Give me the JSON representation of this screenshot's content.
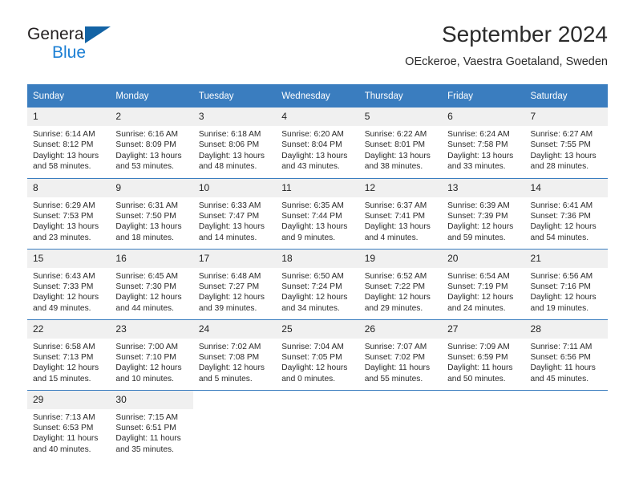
{
  "brand": {
    "name_part1": "General",
    "name_part2": "Blue",
    "flag_color": "#1363a5",
    "blue_color": "#1c7fd4"
  },
  "header": {
    "title": "September 2024",
    "subtitle": "OEckeroe, Vaestra Goetaland, Sweden"
  },
  "theme": {
    "header_bg": "#3a7dbf",
    "daynum_bg": "#f0f0f0",
    "grid_line": "#3a7dbf"
  },
  "weekday_headers": [
    "Sunday",
    "Monday",
    "Tuesday",
    "Wednesday",
    "Thursday",
    "Friday",
    "Saturday"
  ],
  "weeks": [
    [
      {
        "day": "1",
        "sunrise": "Sunrise: 6:14 AM",
        "sunset": "Sunset: 8:12 PM",
        "daylight_line1": "Daylight: 13 hours",
        "daylight_line2": "and 58 minutes."
      },
      {
        "day": "2",
        "sunrise": "Sunrise: 6:16 AM",
        "sunset": "Sunset: 8:09 PM",
        "daylight_line1": "Daylight: 13 hours",
        "daylight_line2": "and 53 minutes."
      },
      {
        "day": "3",
        "sunrise": "Sunrise: 6:18 AM",
        "sunset": "Sunset: 8:06 PM",
        "daylight_line1": "Daylight: 13 hours",
        "daylight_line2": "and 48 minutes."
      },
      {
        "day": "4",
        "sunrise": "Sunrise: 6:20 AM",
        "sunset": "Sunset: 8:04 PM",
        "daylight_line1": "Daylight: 13 hours",
        "daylight_line2": "and 43 minutes."
      },
      {
        "day": "5",
        "sunrise": "Sunrise: 6:22 AM",
        "sunset": "Sunset: 8:01 PM",
        "daylight_line1": "Daylight: 13 hours",
        "daylight_line2": "and 38 minutes."
      },
      {
        "day": "6",
        "sunrise": "Sunrise: 6:24 AM",
        "sunset": "Sunset: 7:58 PM",
        "daylight_line1": "Daylight: 13 hours",
        "daylight_line2": "and 33 minutes."
      },
      {
        "day": "7",
        "sunrise": "Sunrise: 6:27 AM",
        "sunset": "Sunset: 7:55 PM",
        "daylight_line1": "Daylight: 13 hours",
        "daylight_line2": "and 28 minutes."
      }
    ],
    [
      {
        "day": "8",
        "sunrise": "Sunrise: 6:29 AM",
        "sunset": "Sunset: 7:53 PM",
        "daylight_line1": "Daylight: 13 hours",
        "daylight_line2": "and 23 minutes."
      },
      {
        "day": "9",
        "sunrise": "Sunrise: 6:31 AM",
        "sunset": "Sunset: 7:50 PM",
        "daylight_line1": "Daylight: 13 hours",
        "daylight_line2": "and 18 minutes."
      },
      {
        "day": "10",
        "sunrise": "Sunrise: 6:33 AM",
        "sunset": "Sunset: 7:47 PM",
        "daylight_line1": "Daylight: 13 hours",
        "daylight_line2": "and 14 minutes."
      },
      {
        "day": "11",
        "sunrise": "Sunrise: 6:35 AM",
        "sunset": "Sunset: 7:44 PM",
        "daylight_line1": "Daylight: 13 hours",
        "daylight_line2": "and 9 minutes."
      },
      {
        "day": "12",
        "sunrise": "Sunrise: 6:37 AM",
        "sunset": "Sunset: 7:41 PM",
        "daylight_line1": "Daylight: 13 hours",
        "daylight_line2": "and 4 minutes."
      },
      {
        "day": "13",
        "sunrise": "Sunrise: 6:39 AM",
        "sunset": "Sunset: 7:39 PM",
        "daylight_line1": "Daylight: 12 hours",
        "daylight_line2": "and 59 minutes."
      },
      {
        "day": "14",
        "sunrise": "Sunrise: 6:41 AM",
        "sunset": "Sunset: 7:36 PM",
        "daylight_line1": "Daylight: 12 hours",
        "daylight_line2": "and 54 minutes."
      }
    ],
    [
      {
        "day": "15",
        "sunrise": "Sunrise: 6:43 AM",
        "sunset": "Sunset: 7:33 PM",
        "daylight_line1": "Daylight: 12 hours",
        "daylight_line2": "and 49 minutes."
      },
      {
        "day": "16",
        "sunrise": "Sunrise: 6:45 AM",
        "sunset": "Sunset: 7:30 PM",
        "daylight_line1": "Daylight: 12 hours",
        "daylight_line2": "and 44 minutes."
      },
      {
        "day": "17",
        "sunrise": "Sunrise: 6:48 AM",
        "sunset": "Sunset: 7:27 PM",
        "daylight_line1": "Daylight: 12 hours",
        "daylight_line2": "and 39 minutes."
      },
      {
        "day": "18",
        "sunrise": "Sunrise: 6:50 AM",
        "sunset": "Sunset: 7:24 PM",
        "daylight_line1": "Daylight: 12 hours",
        "daylight_line2": "and 34 minutes."
      },
      {
        "day": "19",
        "sunrise": "Sunrise: 6:52 AM",
        "sunset": "Sunset: 7:22 PM",
        "daylight_line1": "Daylight: 12 hours",
        "daylight_line2": "and 29 minutes."
      },
      {
        "day": "20",
        "sunrise": "Sunrise: 6:54 AM",
        "sunset": "Sunset: 7:19 PM",
        "daylight_line1": "Daylight: 12 hours",
        "daylight_line2": "and 24 minutes."
      },
      {
        "day": "21",
        "sunrise": "Sunrise: 6:56 AM",
        "sunset": "Sunset: 7:16 PM",
        "daylight_line1": "Daylight: 12 hours",
        "daylight_line2": "and 19 minutes."
      }
    ],
    [
      {
        "day": "22",
        "sunrise": "Sunrise: 6:58 AM",
        "sunset": "Sunset: 7:13 PM",
        "daylight_line1": "Daylight: 12 hours",
        "daylight_line2": "and 15 minutes."
      },
      {
        "day": "23",
        "sunrise": "Sunrise: 7:00 AM",
        "sunset": "Sunset: 7:10 PM",
        "daylight_line1": "Daylight: 12 hours",
        "daylight_line2": "and 10 minutes."
      },
      {
        "day": "24",
        "sunrise": "Sunrise: 7:02 AM",
        "sunset": "Sunset: 7:08 PM",
        "daylight_line1": "Daylight: 12 hours",
        "daylight_line2": "and 5 minutes."
      },
      {
        "day": "25",
        "sunrise": "Sunrise: 7:04 AM",
        "sunset": "Sunset: 7:05 PM",
        "daylight_line1": "Daylight: 12 hours",
        "daylight_line2": "and 0 minutes."
      },
      {
        "day": "26",
        "sunrise": "Sunrise: 7:07 AM",
        "sunset": "Sunset: 7:02 PM",
        "daylight_line1": "Daylight: 11 hours",
        "daylight_line2": "and 55 minutes."
      },
      {
        "day": "27",
        "sunrise": "Sunrise: 7:09 AM",
        "sunset": "Sunset: 6:59 PM",
        "daylight_line1": "Daylight: 11 hours",
        "daylight_line2": "and 50 minutes."
      },
      {
        "day": "28",
        "sunrise": "Sunrise: 7:11 AM",
        "sunset": "Sunset: 6:56 PM",
        "daylight_line1": "Daylight: 11 hours",
        "daylight_line2": "and 45 minutes."
      }
    ],
    [
      {
        "day": "29",
        "sunrise": "Sunrise: 7:13 AM",
        "sunset": "Sunset: 6:53 PM",
        "daylight_line1": "Daylight: 11 hours",
        "daylight_line2": "and 40 minutes."
      },
      {
        "day": "30",
        "sunrise": "Sunrise: 7:15 AM",
        "sunset": "Sunset: 6:51 PM",
        "daylight_line1": "Daylight: 11 hours",
        "daylight_line2": "and 35 minutes."
      },
      {
        "day": "",
        "sunrise": "",
        "sunset": "",
        "daylight_line1": "",
        "daylight_line2": ""
      },
      {
        "day": "",
        "sunrise": "",
        "sunset": "",
        "daylight_line1": "",
        "daylight_line2": ""
      },
      {
        "day": "",
        "sunrise": "",
        "sunset": "",
        "daylight_line1": "",
        "daylight_line2": ""
      },
      {
        "day": "",
        "sunrise": "",
        "sunset": "",
        "daylight_line1": "",
        "daylight_line2": ""
      },
      {
        "day": "",
        "sunrise": "",
        "sunset": "",
        "daylight_line1": "",
        "daylight_line2": ""
      }
    ]
  ]
}
